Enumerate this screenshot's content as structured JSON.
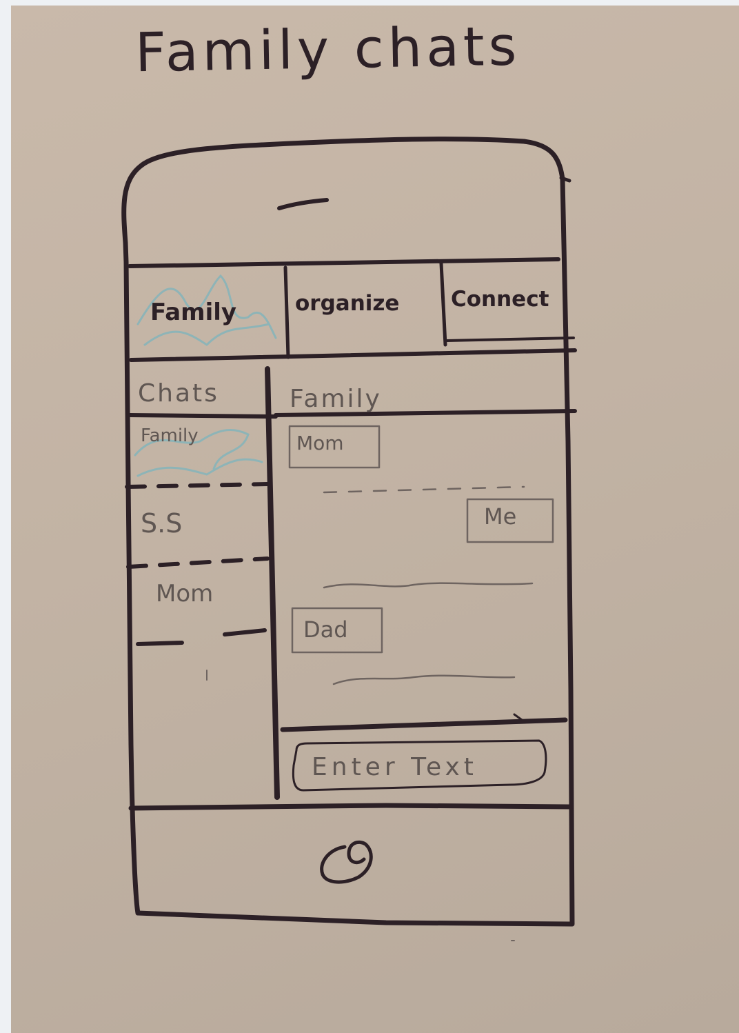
{
  "title": "Family chats",
  "tabs": [
    {
      "label": "Family",
      "selected": true
    },
    {
      "label": "organize",
      "selected": false
    },
    {
      "label": "Connect",
      "selected": false
    }
  ],
  "sidebar": {
    "header": "Chats",
    "items": [
      {
        "label": "Family",
        "selected": true
      },
      {
        "label": "S.S",
        "selected": false
      },
      {
        "label": "Mom",
        "selected": false
      }
    ]
  },
  "conversation": {
    "header": "Family",
    "messages": [
      {
        "sender": "Mom",
        "side": "left"
      },
      {
        "sender": "Me",
        "side": "right"
      },
      {
        "sender": "Dad",
        "side": "left"
      }
    ],
    "input_placeholder": "Enter Text"
  },
  "colors": {
    "ink": "#2c2026",
    "highlight": "#7fb4bb",
    "paper": "#c4b5a6"
  },
  "icons": [
    "speaker-icon",
    "home-button-icon"
  ]
}
